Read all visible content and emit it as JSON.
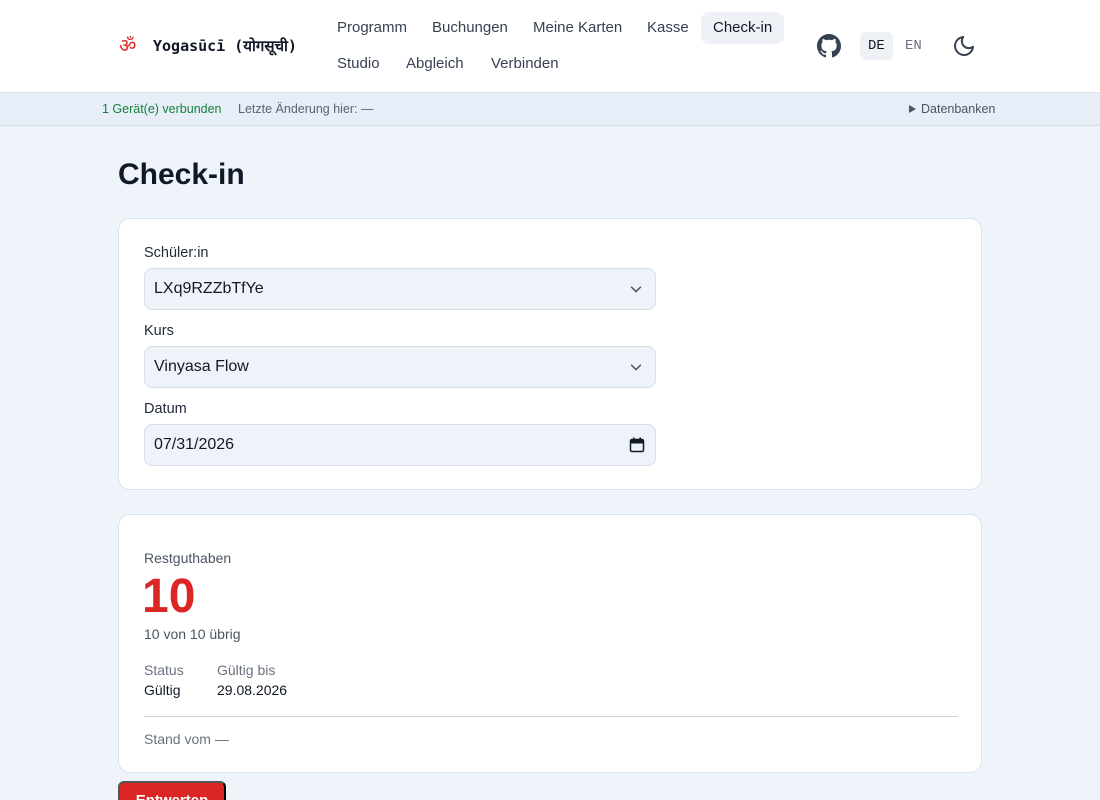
{
  "app": {
    "title": "Yogasūcī (योगसूची)",
    "logo_icon": "om-icon"
  },
  "nav": {
    "items": [
      {
        "label": "Programm"
      },
      {
        "label": "Buchungen"
      },
      {
        "label": "Meine Karten"
      },
      {
        "label": "Kasse"
      },
      {
        "label": "Check-in",
        "active": true
      },
      {
        "label": "Studio"
      },
      {
        "label": "Abgleich"
      },
      {
        "label": "Verbinden"
      }
    ],
    "github_icon": "github-icon",
    "languages": [
      {
        "label": "DE",
        "selected": true
      },
      {
        "label": "EN",
        "selected": false
      }
    ],
    "theme_icon": "moon-icon"
  },
  "statusbar": {
    "connected": "1 Gerät(e) verbunden",
    "last_change": "Letzte Änderung hier: —",
    "databases": "Datenbanken"
  },
  "page": {
    "title": "Check-in"
  },
  "form": {
    "student_label": "Schüler:in",
    "student_value": "LXq9RZZbTfYe",
    "course_label": "Kurs",
    "course_value": "Vinyasa Flow",
    "date_label": "Datum",
    "date_value": "07/31/2026"
  },
  "balance": {
    "label": "Restguthaben",
    "value": "10",
    "subtitle": "10 von 10 übrig",
    "status_label": "Status",
    "status_value": "Gültig",
    "valid_label": "Gültig bis",
    "valid_value": "29.08.2026",
    "stand": "Stand vom —"
  },
  "actions": {
    "void_label": "Entwerten"
  },
  "colors": {
    "accent_red": "#dc2626",
    "connected_green": "#15803d",
    "background": "#eff3fa"
  }
}
